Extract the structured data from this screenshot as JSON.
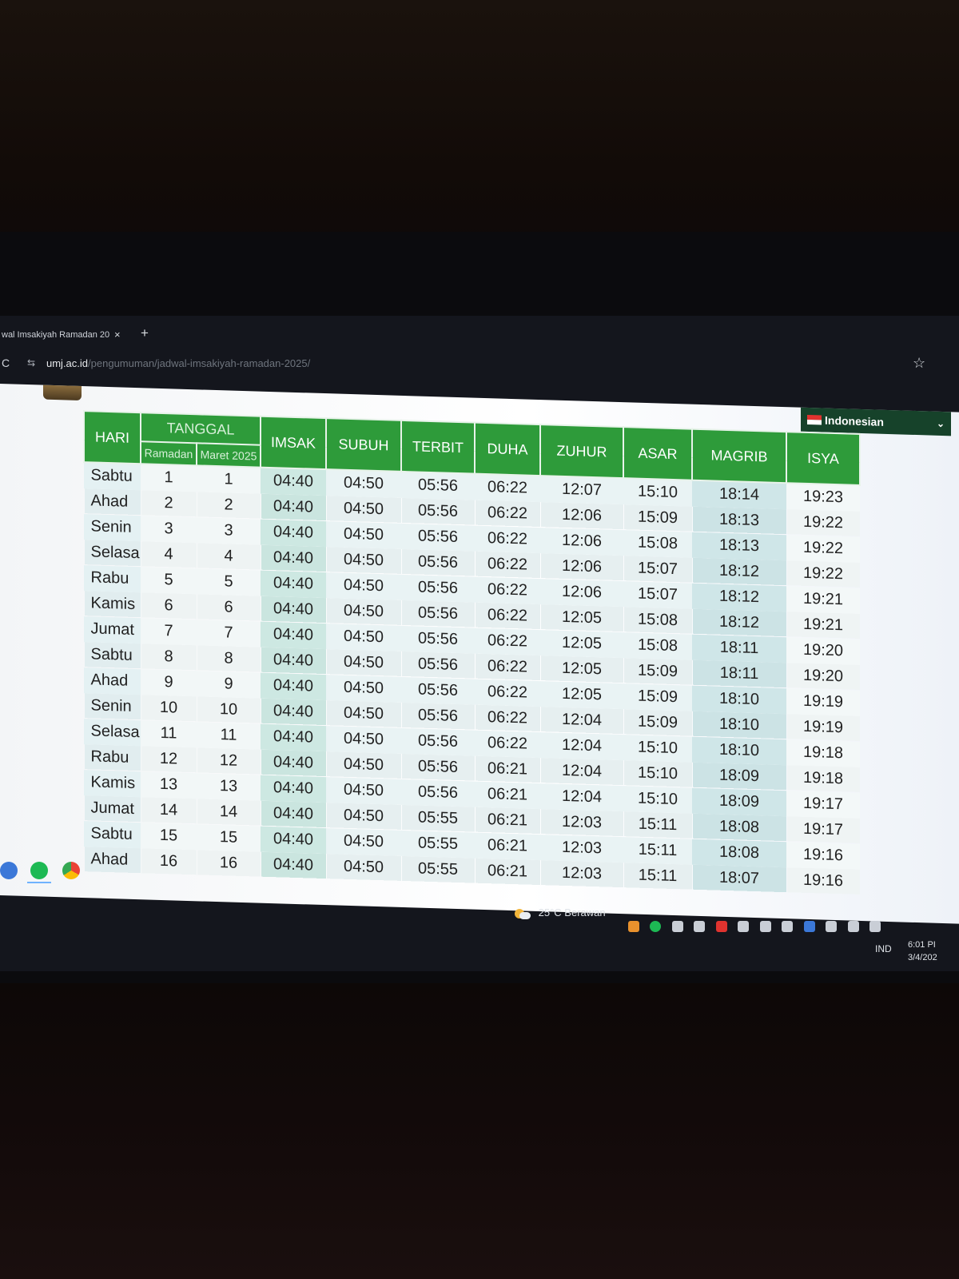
{
  "browser": {
    "tab_title": "wal Imsakiyah Ramadan 20",
    "tab_close": "×",
    "new_tab": "+",
    "reload_icon": "reload-icon",
    "url_host": "umj.ac.id",
    "url_path": "/pengumuman/jadwal-imsakiyah-ramadan-2025/",
    "bookmark_icon": "star-icon"
  },
  "page": {
    "language": "Indonesian",
    "table": {
      "headers": {
        "hari": "HARI",
        "tanggal": "TANGGAL",
        "ramadan": "Ramadan",
        "maret": "Maret 2025",
        "imsak": "IMSAK",
        "subuh": "SUBUH",
        "terbit": "TERBIT",
        "duha": "DUHA",
        "zuhur": "ZUHUR",
        "asar": "ASAR",
        "magrib": "MAGRIB",
        "isya": "ISYA"
      },
      "rows": [
        {
          "hari": "Sabtu",
          "ramadan": "1",
          "maret": "1",
          "imsak": "04:40",
          "subuh": "04:50",
          "terbit": "05:56",
          "duha": "06:22",
          "zuhur": "12:07",
          "asar": "15:10",
          "magrib": "18:14",
          "isya": "19:23"
        },
        {
          "hari": "Ahad",
          "ramadan": "2",
          "maret": "2",
          "imsak": "04:40",
          "subuh": "04:50",
          "terbit": "05:56",
          "duha": "06:22",
          "zuhur": "12:06",
          "asar": "15:09",
          "magrib": "18:13",
          "isya": "19:22"
        },
        {
          "hari": "Senin",
          "ramadan": "3",
          "maret": "3",
          "imsak": "04:40",
          "subuh": "04:50",
          "terbit": "05:56",
          "duha": "06:22",
          "zuhur": "12:06",
          "asar": "15:08",
          "magrib": "18:13",
          "isya": "19:22"
        },
        {
          "hari": "Selasa",
          "ramadan": "4",
          "maret": "4",
          "imsak": "04:40",
          "subuh": "04:50",
          "terbit": "05:56",
          "duha": "06:22",
          "zuhur": "12:06",
          "asar": "15:07",
          "magrib": "18:12",
          "isya": "19:22"
        },
        {
          "hari": "Rabu",
          "ramadan": "5",
          "maret": "5",
          "imsak": "04:40",
          "subuh": "04:50",
          "terbit": "05:56",
          "duha": "06:22",
          "zuhur": "12:06",
          "asar": "15:07",
          "magrib": "18:12",
          "isya": "19:21"
        },
        {
          "hari": "Kamis",
          "ramadan": "6",
          "maret": "6",
          "imsak": "04:40",
          "subuh": "04:50",
          "terbit": "05:56",
          "duha": "06:22",
          "zuhur": "12:05",
          "asar": "15:08",
          "magrib": "18:12",
          "isya": "19:21"
        },
        {
          "hari": "Jumat",
          "ramadan": "7",
          "maret": "7",
          "imsak": "04:40",
          "subuh": "04:50",
          "terbit": "05:56",
          "duha": "06:22",
          "zuhur": "12:05",
          "asar": "15:08",
          "magrib": "18:11",
          "isya": "19:20"
        },
        {
          "hari": "Sabtu",
          "ramadan": "8",
          "maret": "8",
          "imsak": "04:40",
          "subuh": "04:50",
          "terbit": "05:56",
          "duha": "06:22",
          "zuhur": "12:05",
          "asar": "15:09",
          "magrib": "18:11",
          "isya": "19:20"
        },
        {
          "hari": "Ahad",
          "ramadan": "9",
          "maret": "9",
          "imsak": "04:40",
          "subuh": "04:50",
          "terbit": "05:56",
          "duha": "06:22",
          "zuhur": "12:05",
          "asar": "15:09",
          "magrib": "18:10",
          "isya": "19:19"
        },
        {
          "hari": "Senin",
          "ramadan": "10",
          "maret": "10",
          "imsak": "04:40",
          "subuh": "04:50",
          "terbit": "05:56",
          "duha": "06:22",
          "zuhur": "12:04",
          "asar": "15:09",
          "magrib": "18:10",
          "isya": "19:19"
        },
        {
          "hari": "Selasa",
          "ramadan": "11",
          "maret": "11",
          "imsak": "04:40",
          "subuh": "04:50",
          "terbit": "05:56",
          "duha": "06:22",
          "zuhur": "12:04",
          "asar": "15:10",
          "magrib": "18:10",
          "isya": "19:18"
        },
        {
          "hari": "Rabu",
          "ramadan": "12",
          "maret": "12",
          "imsak": "04:40",
          "subuh": "04:50",
          "terbit": "05:56",
          "duha": "06:21",
          "zuhur": "12:04",
          "asar": "15:10",
          "magrib": "18:09",
          "isya": "19:18"
        },
        {
          "hari": "Kamis",
          "ramadan": "13",
          "maret": "13",
          "imsak": "04:40",
          "subuh": "04:50",
          "terbit": "05:56",
          "duha": "06:21",
          "zuhur": "12:04",
          "asar": "15:10",
          "magrib": "18:09",
          "isya": "19:17"
        },
        {
          "hari": "Jumat",
          "ramadan": "14",
          "maret": "14",
          "imsak": "04:40",
          "subuh": "04:50",
          "terbit": "05:55",
          "duha": "06:21",
          "zuhur": "12:03",
          "asar": "15:11",
          "magrib": "18:08",
          "isya": "19:17"
        },
        {
          "hari": "Sabtu",
          "ramadan": "15",
          "maret": "15",
          "imsak": "04:40",
          "subuh": "04:50",
          "terbit": "05:55",
          "duha": "06:21",
          "zuhur": "12:03",
          "asar": "15:11",
          "magrib": "18:08",
          "isya": "19:16"
        },
        {
          "hari": "Ahad",
          "ramadan": "16",
          "maret": "16",
          "imsak": "04:40",
          "subuh": "04:50",
          "terbit": "05:55",
          "duha": "06:21",
          "zuhur": "12:03",
          "asar": "15:11",
          "magrib": "18:07",
          "isya": "19:16"
        }
      ]
    }
  },
  "taskbar": {
    "weather_temp": "25°C",
    "weather_text": "Berawan",
    "input_lang": "IND",
    "time": "6:01 PI",
    "date": "3/4/202"
  },
  "colors": {
    "header_green": "#2e9b3a",
    "imsak_column": "#cde8e2",
    "language_bar": "#16422a"
  }
}
